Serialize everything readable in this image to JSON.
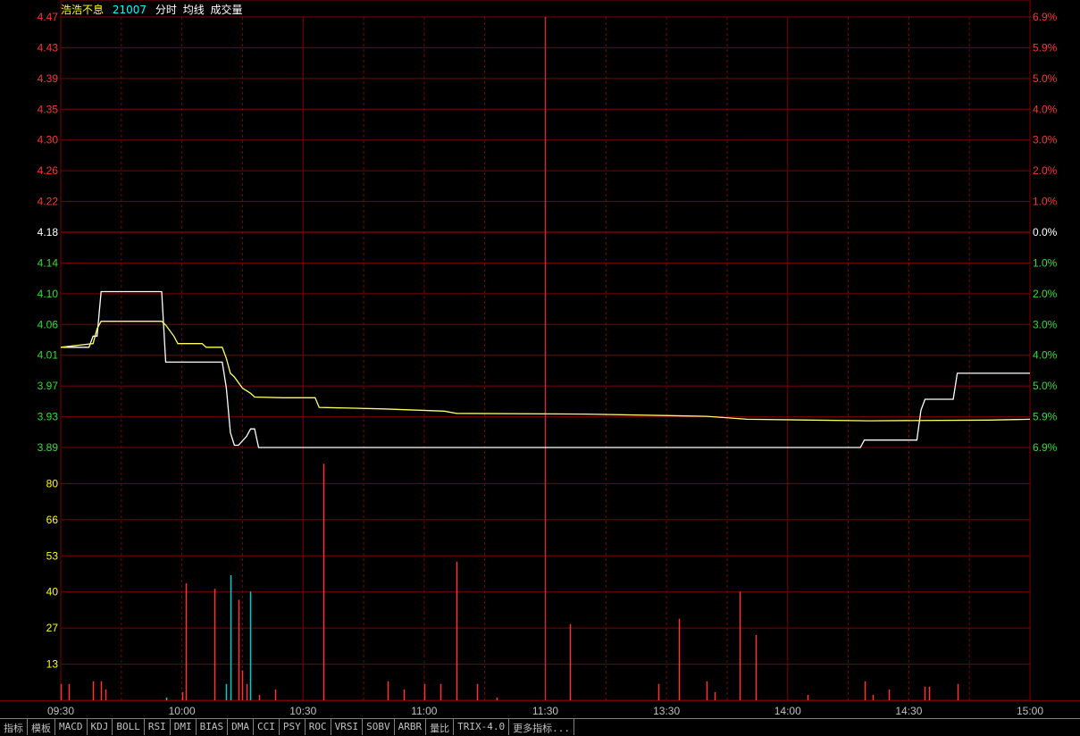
{
  "header": {
    "name": "浩浩不息",
    "code": "21007",
    "labels": [
      "分时",
      "均线",
      "成交量"
    ]
  },
  "colors": {
    "up": "#ff3333",
    "down": "#33dd33",
    "flat": "#ffffff",
    "grid": "#800000",
    "price_line": "#ffffff",
    "avg_line": "#ffff66",
    "vol_label": "#ffff00",
    "vol_bar": "#ff3333",
    "vol_bar_alt": "#00cccc",
    "axis_time": "#c0c0c0",
    "header_name": "#ffff00",
    "header_code": "#00ffff",
    "header_label": "#ffffff"
  },
  "toolbar": [
    "指标",
    "模板",
    "MACD",
    "KDJ",
    "BOLL",
    "RSI",
    "DMI",
    "BIAS",
    "DMA",
    "CCI",
    "PSY",
    "ROC",
    "VRSI",
    "SOBV",
    "ARBR",
    "量比",
    "TRIX-4.0",
    "更多指标..."
  ],
  "chart_data": {
    "type": "line",
    "price_ticks": [
      "4.47",
      "4.43",
      "4.39",
      "4.35",
      "4.30",
      "4.26",
      "4.22",
      "4.18",
      "4.14",
      "4.10",
      "4.06",
      "4.01",
      "3.97",
      "3.93",
      "3.89"
    ],
    "pct_ticks": [
      "6.9%",
      "5.9%",
      "5.0%",
      "4.0%",
      "3.0%",
      "2.0%",
      "1.0%",
      "0.0%",
      "1.0%",
      "2.0%",
      "3.0%",
      "4.0%",
      "5.0%",
      "5.9%",
      "6.9%"
    ],
    "price_range": [
      3.89,
      4.47
    ],
    "pre_close": 4.18,
    "vol_ticks": [
      "80",
      "66",
      "53",
      "40",
      "27",
      "13"
    ],
    "vol_range": [
      0,
      93
    ],
    "time_ticks": [
      "09:30",
      "10:00",
      "10:30",
      "11:00",
      "11:30",
      "13:30",
      "14:00",
      "14:30",
      "15:00"
    ],
    "minutes": 240,
    "series": [
      {
        "key": "price",
        "points": [
          [
            0,
            4.025
          ],
          [
            7,
            4.025
          ],
          [
            8,
            4.04
          ],
          [
            9,
            4.04
          ],
          [
            10,
            4.1
          ],
          [
            25,
            4.1
          ],
          [
            26,
            4.005
          ],
          [
            40,
            4.005
          ],
          [
            41,
            3.97
          ],
          [
            42,
            3.91
          ],
          [
            43,
            3.893
          ],
          [
            44,
            3.893
          ],
          [
            46,
            3.905
          ],
          [
            47,
            3.915
          ],
          [
            48,
            3.915
          ],
          [
            49,
            3.89
          ],
          [
            198,
            3.89
          ],
          [
            199,
            3.9
          ],
          [
            212,
            3.9
          ],
          [
            213,
            3.94
          ],
          [
            214,
            3.955
          ],
          [
            221,
            3.955
          ],
          [
            222,
            3.99
          ],
          [
            240,
            3.99
          ]
        ]
      },
      {
        "key": "average",
        "points": [
          [
            0,
            4.025
          ],
          [
            8,
            4.03
          ],
          [
            9,
            4.05
          ],
          [
            10,
            4.06
          ],
          [
            25,
            4.06
          ],
          [
            26,
            4.055
          ],
          [
            28,
            4.04
          ],
          [
            29,
            4.03
          ],
          [
            35,
            4.03
          ],
          [
            36,
            4.025
          ],
          [
            40,
            4.025
          ],
          [
            41,
            4.01
          ],
          [
            42,
            3.99
          ],
          [
            43,
            3.985
          ],
          [
            45,
            3.97
          ],
          [
            47,
            3.963
          ],
          [
            48,
            3.958
          ],
          [
            55,
            3.957
          ],
          [
            63,
            3.957
          ],
          [
            64,
            3.944
          ],
          [
            80,
            3.942
          ],
          [
            95,
            3.939
          ],
          [
            98,
            3.936
          ],
          [
            130,
            3.935
          ],
          [
            160,
            3.932
          ],
          [
            170,
            3.928
          ],
          [
            200,
            3.926
          ],
          [
            230,
            3.927
          ],
          [
            240,
            3.928
          ]
        ]
      }
    ],
    "volume": [
      [
        0,
        6
      ],
      [
        2,
        6
      ],
      [
        8,
        7
      ],
      [
        10,
        7
      ],
      [
        11,
        4
      ],
      [
        26,
        1
      ],
      [
        30,
        3
      ],
      [
        31,
        43
      ],
      [
        38,
        41
      ],
      [
        41,
        6
      ],
      [
        42,
        46
      ],
      [
        44,
        37
      ],
      [
        45,
        11
      ],
      [
        46,
        6
      ],
      [
        47,
        40
      ],
      [
        49,
        2
      ],
      [
        53,
        4
      ],
      [
        65,
        87
      ],
      [
        81,
        7
      ],
      [
        85,
        4
      ],
      [
        90,
        6
      ],
      [
        94,
        6
      ],
      [
        98,
        51
      ],
      [
        103,
        6
      ],
      [
        108,
        1
      ],
      [
        126,
        28
      ],
      [
        148,
        6
      ],
      [
        153,
        30
      ],
      [
        160,
        7
      ],
      [
        162,
        3
      ],
      [
        168,
        40
      ],
      [
        172,
        24
      ],
      [
        185,
        2
      ],
      [
        199,
        7
      ],
      [
        201,
        2
      ],
      [
        205,
        4
      ],
      [
        214,
        5
      ],
      [
        215,
        5
      ],
      [
        222,
        6
      ]
    ],
    "volume_alt_index": [
      26,
      41,
      42,
      47
    ]
  }
}
